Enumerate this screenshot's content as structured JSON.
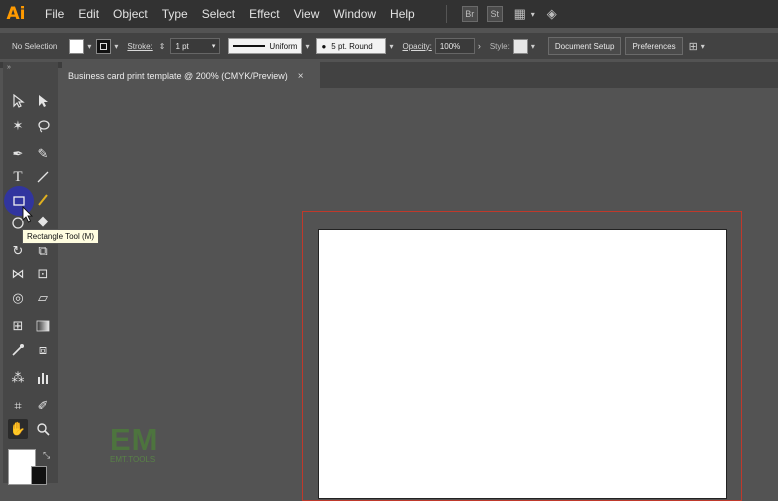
{
  "app": {
    "logo": "Ai"
  },
  "menu": [
    "File",
    "Edit",
    "Object",
    "Type",
    "Select",
    "Effect",
    "View",
    "Window",
    "Help"
  ],
  "menubar_icons": [
    {
      "name": "bridge-icon",
      "glyph": "Br"
    },
    {
      "name": "stock-icon",
      "glyph": "St"
    },
    {
      "name": "workspace-layout-icon",
      "glyph": "▦"
    },
    {
      "name": "gpu-performance-icon",
      "glyph": "◈"
    }
  ],
  "control": {
    "selection": "No Selection",
    "stroke_label": "Stroke:",
    "stroke_weight": "1 pt",
    "stroke_profile": "Uniform",
    "brush": "5 pt. Round",
    "opacity_label": "Opacity:",
    "opacity_value": "100%",
    "style_label": "Style:",
    "document_setup": "Document Setup",
    "preferences": "Preferences"
  },
  "document_tab": {
    "title": "Business card print template @ 200% (CMYK/Preview)",
    "close": "×"
  },
  "tooltip": "Rectangle Tool (M)",
  "watermark": {
    "big": "EM",
    "small": "EMT.TOOLS"
  },
  "colors": {
    "menubar": "#323232",
    "control": "#424242",
    "canvas": "#535353",
    "bleed": "#c0392b",
    "highlight": "#2f33a8",
    "accent": "#ff9a00"
  }
}
